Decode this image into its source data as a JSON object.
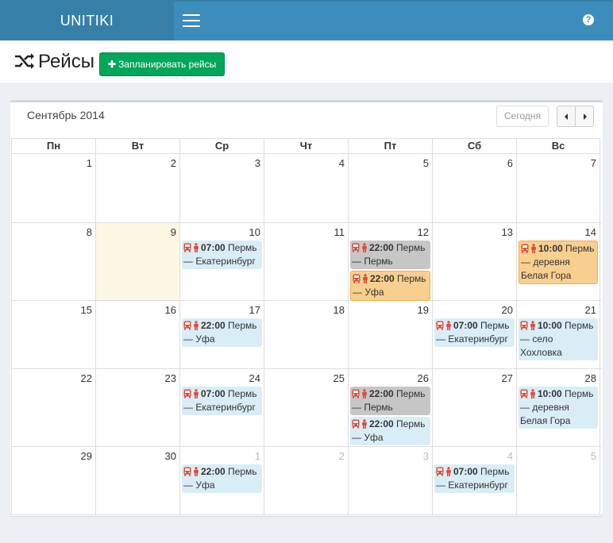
{
  "app": {
    "title": "UNITIKI",
    "help_label": "?"
  },
  "page": {
    "title": "Рейсы",
    "plan_button": "Запланировать рейсы"
  },
  "calendar": {
    "month": "Сентябрь 2014",
    "today_button": "Сегодня",
    "weekdays": [
      "Пн",
      "Вт",
      "Ср",
      "Чт",
      "Пт",
      "Сб",
      "Вс"
    ],
    "weeks": [
      {
        "days": [
          {
            "num": "1",
            "events": []
          },
          {
            "num": "2",
            "events": []
          },
          {
            "num": "3",
            "events": []
          },
          {
            "num": "4",
            "events": []
          },
          {
            "num": "5",
            "events": []
          },
          {
            "num": "6",
            "events": []
          },
          {
            "num": "7",
            "events": []
          }
        ]
      },
      {
        "days": [
          {
            "num": "8",
            "events": []
          },
          {
            "num": "9",
            "today": true,
            "events": []
          },
          {
            "num": "10",
            "events": [
              {
                "time": "07:00",
                "route": "Пермь — Екатеринбург",
                "color": "blue"
              }
            ]
          },
          {
            "num": "11",
            "events": []
          },
          {
            "num": "12",
            "events": [
              {
                "time": "22:00",
                "route": "Пермь — Пермь",
                "color": "gray"
              },
              {
                "time": "22:00",
                "route": "Пермь — Уфа",
                "color": "orange"
              }
            ]
          },
          {
            "num": "13",
            "events": []
          },
          {
            "num": "14",
            "events": [
              {
                "time": "10:00",
                "route": "Пермь — деревня Белая Гора",
                "color": "orange"
              }
            ]
          }
        ]
      },
      {
        "days": [
          {
            "num": "15",
            "events": []
          },
          {
            "num": "16",
            "events": []
          },
          {
            "num": "17",
            "events": [
              {
                "time": "22:00",
                "route": "Пермь — Уфа",
                "color": "blue"
              }
            ]
          },
          {
            "num": "18",
            "events": []
          },
          {
            "num": "19",
            "events": []
          },
          {
            "num": "20",
            "events": [
              {
                "time": "07:00",
                "route": "Пермь — Екатеринбург",
                "color": "blue"
              }
            ]
          },
          {
            "num": "21",
            "events": [
              {
                "time": "10:00",
                "route": "Пермь — село Хохловка",
                "color": "blue"
              }
            ]
          }
        ]
      },
      {
        "days": [
          {
            "num": "22",
            "events": []
          },
          {
            "num": "23",
            "events": []
          },
          {
            "num": "24",
            "events": [
              {
                "time": "07:00",
                "route": "Пермь — Екатеринбург",
                "color": "blue"
              }
            ]
          },
          {
            "num": "25",
            "events": []
          },
          {
            "num": "26",
            "events": [
              {
                "time": "22:00",
                "route": "Пермь — Пермь",
                "color": "gray"
              },
              {
                "time": "22:00",
                "route": "Пермь — Уфа",
                "color": "blue"
              }
            ]
          },
          {
            "num": "27",
            "events": []
          },
          {
            "num": "28",
            "events": [
              {
                "time": "10:00",
                "route": "Пермь — деревня Белая Гора",
                "color": "blue"
              }
            ]
          }
        ]
      },
      {
        "days": [
          {
            "num": "29",
            "events": []
          },
          {
            "num": "30",
            "events": []
          },
          {
            "num": "1",
            "other": true,
            "events": [
              {
                "time": "22:00",
                "route": "Пермь — Уфа",
                "color": "blue"
              }
            ]
          },
          {
            "num": "2",
            "other": true,
            "events": []
          },
          {
            "num": "3",
            "other": true,
            "events": []
          },
          {
            "num": "4",
            "other": true,
            "events": [
              {
                "time": "07:00",
                "route": "Пермь — Екатеринбург",
                "color": "blue"
              }
            ]
          },
          {
            "num": "5",
            "other": true,
            "events": []
          }
        ]
      }
    ]
  },
  "colors": {
    "header": "#3c8dbc",
    "logo_bg": "#367fa9",
    "success": "#00a65a",
    "icon_red": "#dd4b39"
  },
  "icons": {
    "bus": "bus-icon",
    "person": "person-icon",
    "shuffle": "random-icon",
    "menu": "menu-icon"
  }
}
